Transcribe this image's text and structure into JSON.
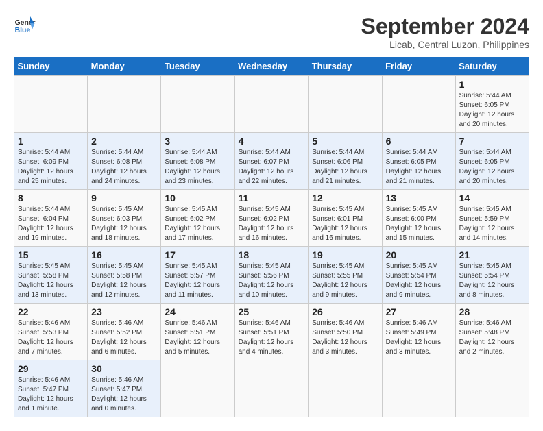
{
  "header": {
    "logo_line1": "General",
    "logo_line2": "Blue",
    "title": "September 2024",
    "subtitle": "Licab, Central Luzon, Philippines"
  },
  "calendar": {
    "days_of_week": [
      "Sunday",
      "Monday",
      "Tuesday",
      "Wednesday",
      "Thursday",
      "Friday",
      "Saturday"
    ],
    "weeks": [
      [
        {
          "day": null
        },
        {
          "day": null
        },
        {
          "day": null
        },
        {
          "day": null
        },
        {
          "day": null
        },
        {
          "day": null
        },
        {
          "day": 1,
          "sunrise": "5:44 AM",
          "sunset": "6:05 PM",
          "daylight": "12 hours and 20 minutes."
        }
      ],
      [
        {
          "day": 1,
          "sunrise": "5:44 AM",
          "sunset": "6:09 PM",
          "daylight": "12 hours and 25 minutes."
        },
        {
          "day": 2,
          "sunrise": "5:44 AM",
          "sunset": "6:08 PM",
          "daylight": "12 hours and 24 minutes."
        },
        {
          "day": 3,
          "sunrise": "5:44 AM",
          "sunset": "6:08 PM",
          "daylight": "12 hours and 23 minutes."
        },
        {
          "day": 4,
          "sunrise": "5:44 AM",
          "sunset": "6:07 PM",
          "daylight": "12 hours and 22 minutes."
        },
        {
          "day": 5,
          "sunrise": "5:44 AM",
          "sunset": "6:06 PM",
          "daylight": "12 hours and 21 minutes."
        },
        {
          "day": 6,
          "sunrise": "5:44 AM",
          "sunset": "6:05 PM",
          "daylight": "12 hours and 21 minutes."
        },
        {
          "day": 7,
          "sunrise": "5:44 AM",
          "sunset": "6:05 PM",
          "daylight": "12 hours and 20 minutes."
        }
      ],
      [
        {
          "day": 8,
          "sunrise": "5:44 AM",
          "sunset": "6:04 PM",
          "daylight": "12 hours and 19 minutes."
        },
        {
          "day": 9,
          "sunrise": "5:45 AM",
          "sunset": "6:03 PM",
          "daylight": "12 hours and 18 minutes."
        },
        {
          "day": 10,
          "sunrise": "5:45 AM",
          "sunset": "6:02 PM",
          "daylight": "12 hours and 17 minutes."
        },
        {
          "day": 11,
          "sunrise": "5:45 AM",
          "sunset": "6:02 PM",
          "daylight": "12 hours and 16 minutes."
        },
        {
          "day": 12,
          "sunrise": "5:45 AM",
          "sunset": "6:01 PM",
          "daylight": "12 hours and 16 minutes."
        },
        {
          "day": 13,
          "sunrise": "5:45 AM",
          "sunset": "6:00 PM",
          "daylight": "12 hours and 15 minutes."
        },
        {
          "day": 14,
          "sunrise": "5:45 AM",
          "sunset": "5:59 PM",
          "daylight": "12 hours and 14 minutes."
        }
      ],
      [
        {
          "day": 15,
          "sunrise": "5:45 AM",
          "sunset": "5:58 PM",
          "daylight": "12 hours and 13 minutes."
        },
        {
          "day": 16,
          "sunrise": "5:45 AM",
          "sunset": "5:58 PM",
          "daylight": "12 hours and 12 minutes."
        },
        {
          "day": 17,
          "sunrise": "5:45 AM",
          "sunset": "5:57 PM",
          "daylight": "12 hours and 11 minutes."
        },
        {
          "day": 18,
          "sunrise": "5:45 AM",
          "sunset": "5:56 PM",
          "daylight": "12 hours and 10 minutes."
        },
        {
          "day": 19,
          "sunrise": "5:45 AM",
          "sunset": "5:55 PM",
          "daylight": "12 hours and 9 minutes."
        },
        {
          "day": 20,
          "sunrise": "5:45 AM",
          "sunset": "5:54 PM",
          "daylight": "12 hours and 9 minutes."
        },
        {
          "day": 21,
          "sunrise": "5:45 AM",
          "sunset": "5:54 PM",
          "daylight": "12 hours and 8 minutes."
        }
      ],
      [
        {
          "day": 22,
          "sunrise": "5:46 AM",
          "sunset": "5:53 PM",
          "daylight": "12 hours and 7 minutes."
        },
        {
          "day": 23,
          "sunrise": "5:46 AM",
          "sunset": "5:52 PM",
          "daylight": "12 hours and 6 minutes."
        },
        {
          "day": 24,
          "sunrise": "5:46 AM",
          "sunset": "5:51 PM",
          "daylight": "12 hours and 5 minutes."
        },
        {
          "day": 25,
          "sunrise": "5:46 AM",
          "sunset": "5:51 PM",
          "daylight": "12 hours and 4 minutes."
        },
        {
          "day": 26,
          "sunrise": "5:46 AM",
          "sunset": "5:50 PM",
          "daylight": "12 hours and 3 minutes."
        },
        {
          "day": 27,
          "sunrise": "5:46 AM",
          "sunset": "5:49 PM",
          "daylight": "12 hours and 3 minutes."
        },
        {
          "day": 28,
          "sunrise": "5:46 AM",
          "sunset": "5:48 PM",
          "daylight": "12 hours and 2 minutes."
        }
      ],
      [
        {
          "day": 29,
          "sunrise": "5:46 AM",
          "sunset": "5:47 PM",
          "daylight": "12 hours and 1 minute."
        },
        {
          "day": 30,
          "sunrise": "5:46 AM",
          "sunset": "5:47 PM",
          "daylight": "12 hours and 0 minutes."
        },
        {
          "day": null
        },
        {
          "day": null
        },
        {
          "day": null
        },
        {
          "day": null
        },
        {
          "day": null
        }
      ]
    ]
  }
}
